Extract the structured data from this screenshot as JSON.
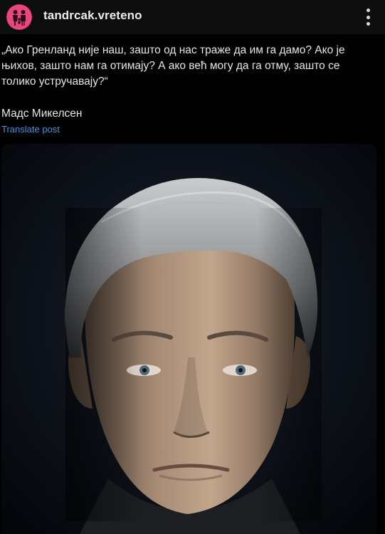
{
  "header": {
    "username": "tandrcak.vreteno",
    "avatar_icon": "family-silhouette-icon",
    "menu_icon": "more-vertical-icon",
    "avatar_color": "#e8467c"
  },
  "post": {
    "quote": "„Ако Гренланд није наш, зашто од нас траже да им га дамо? Ако је њихов, зашто нам га отимају? А ако већ могу да га отму, зашто се толико устручавају?“",
    "author": "Мадс Микелсен",
    "translate_label": "Translate post",
    "link_color": "#4a90d9"
  },
  "media": {
    "type": "portrait-photo",
    "background": "#06080c"
  }
}
